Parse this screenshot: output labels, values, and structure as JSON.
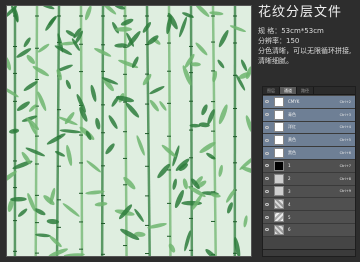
{
  "info": {
    "title": "花纹分层文件",
    "size": "规 格：53cm*53cm",
    "dpi": "分辨率：150",
    "note1": "分色清晰，可以无限循环拼接,",
    "note2": "清晰细腻。"
  },
  "panel": {
    "tabs": [
      "图层",
      "通道",
      "路径"
    ],
    "active_tab": "通道",
    "channels": [
      {
        "name": "CMYK",
        "shortcut": "Ctrl+2",
        "thumb": "white",
        "selected": true
      },
      {
        "name": "青色",
        "shortcut": "Ctrl+3",
        "thumb": "white",
        "selected": true
      },
      {
        "name": "洋红",
        "shortcut": "Ctrl+4",
        "thumb": "white",
        "selected": true
      },
      {
        "name": "黄色",
        "shortcut": "Ctrl+5",
        "thumb": "white",
        "selected": true
      },
      {
        "name": "黑色",
        "shortcut": "Ctrl+6",
        "thumb": "white",
        "selected": true
      },
      {
        "name": "1",
        "shortcut": "Ctrl+7",
        "thumb": "black",
        "selected": false
      },
      {
        "name": "2",
        "shortcut": "Ctrl+8",
        "thumb": "dot",
        "selected": false
      },
      {
        "name": "3",
        "shortcut": "Ctrl+9",
        "thumb": "dot",
        "selected": false
      },
      {
        "name": "4",
        "shortcut": "",
        "thumb": "dot2",
        "selected": false
      },
      {
        "name": "5",
        "shortcut": "",
        "thumb": "dot3",
        "selected": false
      },
      {
        "name": "6",
        "shortcut": "",
        "thumb": "dot2",
        "selected": false
      }
    ]
  },
  "colors": {
    "bamboo_dark": "#2e7d3c",
    "bamboo_light": "#6fb56f",
    "pattern_bg": "#dfeee0"
  }
}
